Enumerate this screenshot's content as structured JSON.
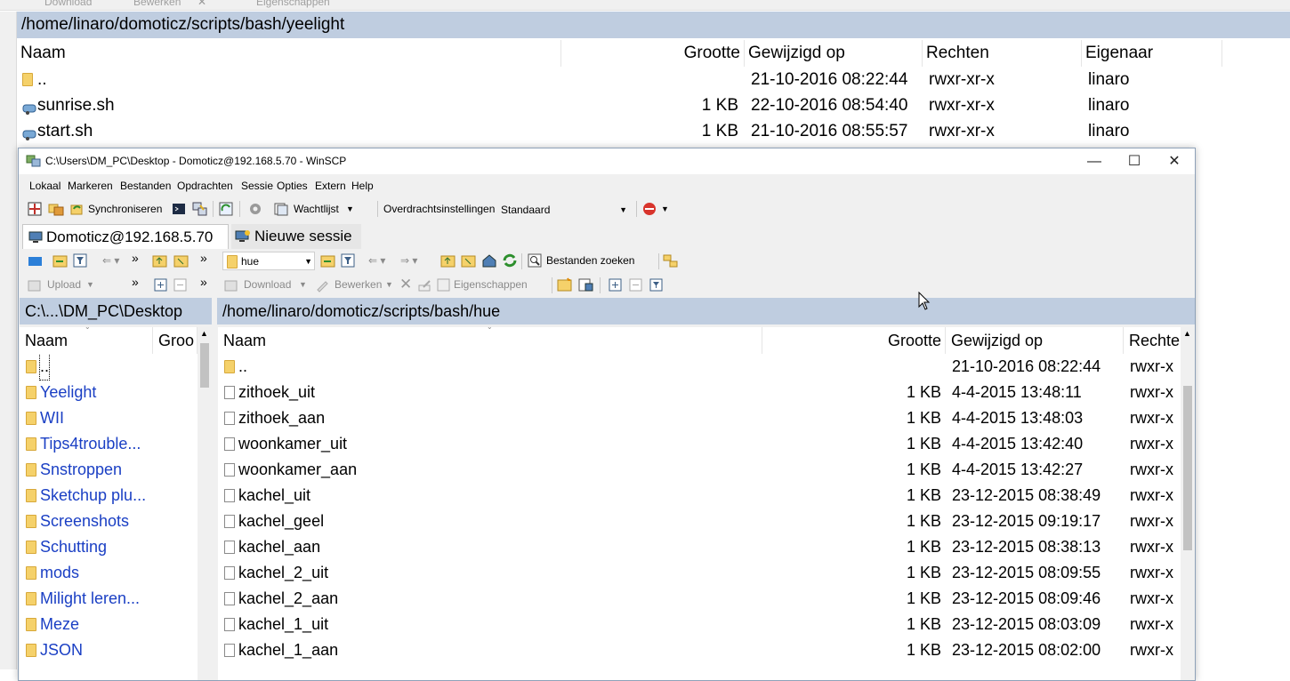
{
  "background": {
    "toolbar": {
      "download": "Download",
      "bewerken": "Bewerken",
      "eigenschappen": "Eigenschappen"
    },
    "path": "/home/linaro/domoticz/scripts/bash/yeelight",
    "columns": {
      "naam": "Naam",
      "grootte": "Grootte",
      "gewijzigd": "Gewijzigd op",
      "rechten": "Rechten",
      "eigenaar": "Eigenaar"
    },
    "rows": [
      {
        "name": "..",
        "size": "",
        "modified": "21-10-2016 08:22:44",
        "rights": "rwxr-xr-x",
        "owner": "linaro",
        "icon": "parent-folder-icon"
      },
      {
        "name": "sunrise.sh",
        "size": "1 KB",
        "modified": "22-10-2016 08:54:40",
        "rights": "rwxr-xr-x",
        "owner": "linaro",
        "icon": "shell-script-icon"
      },
      {
        "name": "start.sh",
        "size": "1 KB",
        "modified": "21-10-2016 08:55:57",
        "rights": "rwxr-xr-x",
        "owner": "linaro",
        "icon": "shell-script-icon"
      }
    ]
  },
  "window": {
    "title": "C:\\Users\\DM_PC\\Desktop - Domoticz@192.168.5.70 - WinSCP",
    "controls": {
      "minimize": "—",
      "maximize": "☐",
      "close": "✕"
    },
    "menu": [
      "Lokaal",
      "Markeren",
      "Bestanden",
      "Opdrachten",
      "Sessie",
      "Opties",
      "Extern",
      "Help"
    ],
    "toolbar": {
      "synchroniseren": "Synchroniseren",
      "wachtlijst": "Wachtlijst",
      "overdracht_label": "Overdrachtsinstellingen",
      "overdracht_value": "Standaard"
    },
    "tabs": {
      "active": "Domoticz@192.168.5.70",
      "new": "Nieuwe sessie"
    },
    "left": {
      "upload": "Upload",
      "path": "C:\\...\\DM_PC\\Desktop",
      "columns": {
        "naam": "Naam",
        "grootte": "Groo"
      },
      "items": [
        "..",
        "Yeelight",
        "WII",
        "Tips4trouble...",
        "Snstroppen",
        "Sketchup plu...",
        "Screenshots",
        "Schutting",
        "mods",
        "Milight leren...",
        "Meze",
        "JSON"
      ]
    },
    "right": {
      "folder_value": "hue",
      "search": "Bestanden zoeken",
      "download": "Download",
      "bewerken": "Bewerken",
      "eigenschappen": "Eigenschappen",
      "path": "/home/linaro/domoticz/scripts/bash/hue",
      "columns": {
        "naam": "Naam",
        "grootte": "Grootte",
        "gewijzigd": "Gewijzigd op",
        "rechten": "Rechte"
      },
      "rows": [
        {
          "name": "..",
          "size": "",
          "modified": "21-10-2016 08:22:44",
          "rights": "rwxr-x"
        },
        {
          "name": "zithoek_uit",
          "size": "1 KB",
          "modified": "4-4-2015 13:48:11",
          "rights": "rwxr-x"
        },
        {
          "name": "zithoek_aan",
          "size": "1 KB",
          "modified": "4-4-2015 13:48:03",
          "rights": "rwxr-x"
        },
        {
          "name": "woonkamer_uit",
          "size": "1 KB",
          "modified": "4-4-2015 13:42:40",
          "rights": "rwxr-x"
        },
        {
          "name": "woonkamer_aan",
          "size": "1 KB",
          "modified": "4-4-2015 13:42:27",
          "rights": "rwxr-x"
        },
        {
          "name": "kachel_uit",
          "size": "1 KB",
          "modified": "23-12-2015 08:38:49",
          "rights": "rwxr-x"
        },
        {
          "name": "kachel_geel",
          "size": "1 KB",
          "modified": "23-12-2015 09:19:17",
          "rights": "rwxr-x"
        },
        {
          "name": "kachel_aan",
          "size": "1 KB",
          "modified": "23-12-2015 08:38:13",
          "rights": "rwxr-x"
        },
        {
          "name": "kachel_2_uit",
          "size": "1 KB",
          "modified": "23-12-2015 08:09:55",
          "rights": "rwxr-x"
        },
        {
          "name": "kachel_2_aan",
          "size": "1 KB",
          "modified": "23-12-2015 08:09:46",
          "rights": "rwxr-x"
        },
        {
          "name": "kachel_1_uit",
          "size": "1 KB",
          "modified": "23-12-2015 08:03:09",
          "rights": "rwxr-x"
        },
        {
          "name": "kachel_1_aan",
          "size": "1 KB",
          "modified": "23-12-2015 08:02:00",
          "rights": "rwxr-x"
        }
      ]
    }
  },
  "colors": {
    "pathbar": "#bfcde0",
    "link": "#1a3fc4",
    "folder": "#f5d16a"
  }
}
